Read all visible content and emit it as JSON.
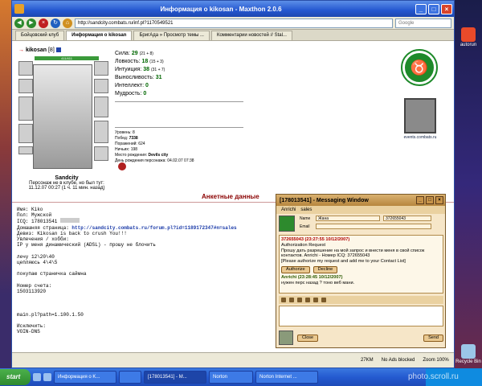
{
  "desktop": {
    "icons": [
      "autorun",
      "Recycle Bin"
    ]
  },
  "browser": {
    "title": "Информация о kikosan - Maxthon 2.0.6",
    "address": "http://sandcity.combats.ru/inf.pl?1170549521",
    "search_placeholder": "Google",
    "tabs": [
      "Бойцовский клуб",
      "Информация о kikosan",
      "БригАда » Просмотр темы ...",
      "Комментарии новостей // Stal..."
    ],
    "status": "27KM",
    "status_items": [
      "No Ads blocked",
      "Zoom 100%"
    ]
  },
  "character": {
    "name": "kikosan",
    "level": "[8]",
    "hp": "411/411",
    "city": "Sandcity",
    "presence": "Персонаж не в клубе, но был тут:",
    "last_seen": "11.12.07 00:27 (1 ч. 11 мин. назад)",
    "stats": [
      {
        "label": "Сила:",
        "value": "29",
        "extra": "(21 + 8)"
      },
      {
        "label": "Ловкость:",
        "value": "18",
        "extra": "(15 + 3)"
      },
      {
        "label": "Интуиция:",
        "value": "38",
        "extra": "(31 + 7)"
      },
      {
        "label": "Выносливость:",
        "value": "31",
        "extra": ""
      },
      {
        "label": "Интеллект:",
        "value": "0",
        "extra": ""
      },
      {
        "label": "Мудрость:",
        "value": "0",
        "extra": ""
      }
    ],
    "record": [
      {
        "label": "Уровень:",
        "value": "8"
      },
      {
        "label": "Побед:",
        "value": "7338"
      },
      {
        "label": "Поражений:",
        "value": "624"
      },
      {
        "label": "Ничьих:",
        "value": "198"
      },
      {
        "label": "Место рождения:",
        "value": "Devils city"
      },
      {
        "label": "День рождения персонажа:",
        "value": "04.02.07 07:38"
      }
    ],
    "events_site": "events.combats.ru"
  },
  "profile": {
    "heading": "Анкетные данные",
    "name": "Имя: Kiko",
    "gender": "Пол: Мужской",
    "icq": "ICQ: 178013541",
    "homepage_label": "Домашняя страница:",
    "homepage": "http://sandcity.combats.ru/forum.pl?id=1189172347#n=sales",
    "motto": "Девиз: Kikosan is back to crush You!!!",
    "hobbies_label": "Увлечения / хобби:",
    "hobby": "IP у меня динамический (ADSL) - прошу не блочить",
    "lines": [
      "лечу 12\\20\\40",
      "цепляюсь 4\\4\\5",
      "",
      "покупаю страничка саймна",
      "",
      "Номер счета:",
      "1503113920",
      "",
      "",
      "",
      "main.pl?path=1.100.1.50",
      "",
      "Исключить:",
      "VOIN-DNS"
    ]
  },
  "messenger": {
    "title": "[178013541] - Messaging Window",
    "tabs": [
      "Anrichi",
      "sales"
    ],
    "name_label": "Name",
    "name_value": "Жана",
    "number": "372655043",
    "email_label": "Email",
    "msg1_time": "372655043 (23:27:55 10/12/2007)",
    "msg1_head": "Authorization Request",
    "msg1_body": "Прошу дать разрешение на мой запрос и внести меня в свой список контактов. Anrichi - Номер ICQ: 372655043",
    "msg1_body2": "[Please authorize my request and add me to your Contact List]",
    "authorize": "Authorize",
    "decline": "Decline",
    "msg2_time": "Anrichi (23:28:45 10/12/2007)",
    "msg2_body": "нужен перс назад ? тоно веб мани.",
    "close_btn": "Close",
    "send_btn": "Send"
  },
  "taskbar": {
    "start": "start",
    "items": [
      "Информация о K...",
      "",
      "[178013541] - M...",
      "Norton",
      "Norton Internet ..."
    ],
    "watermark": "photo.scroll.ru"
  }
}
